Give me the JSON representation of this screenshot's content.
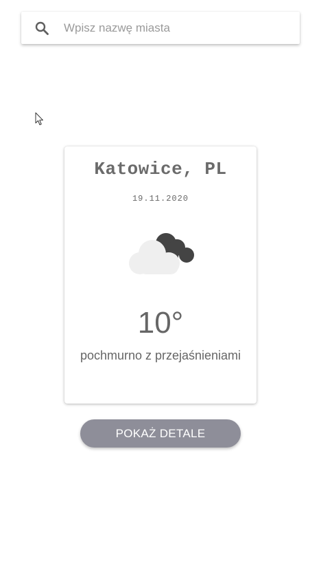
{
  "search": {
    "placeholder": "Wpisz nazwę miasta",
    "value": "",
    "icon": "search-icon"
  },
  "weather": {
    "city": "Katowice, PL",
    "date": "19.11.2020",
    "icon": "partly-cloudy-icon",
    "temperature": "10°",
    "description": "pochmurno z przejaśnieniami"
  },
  "details_button": {
    "label": "POKAŻ DETALE"
  },
  "colors": {
    "button_bg": "#8e8e99",
    "text_gray": "#666666",
    "cloud_light": "#efefef",
    "cloud_dark": "#444444"
  }
}
